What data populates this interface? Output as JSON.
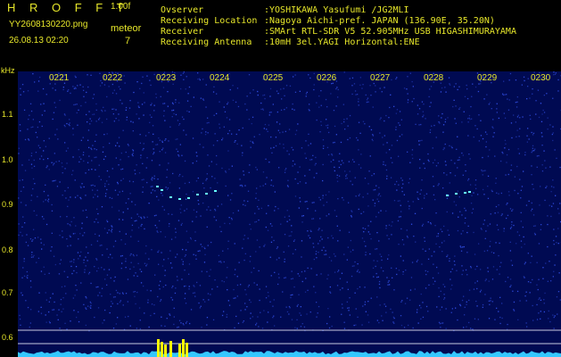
{
  "header": {
    "brand": "H R O F F T",
    "version": "1.00f",
    "filename": "YY2608130220.png",
    "meteor_label": "meteor",
    "datetime": "26.08.13 02:20",
    "meteor_count": "7"
  },
  "info": [
    {
      "key": "Ovserver",
      "value": ":YOSHIKAWA Yasufumi /JG2MLI"
    },
    {
      "key": "Receiving Location",
      "value": ":Nagoya Aichi-pref. JAPAN (136.90E, 35.20N)"
    },
    {
      "key": "Receiver",
      "value": ":SMArt RTL-SDR V5 52.905MHz USB HIGASHIMURAYAMA"
    },
    {
      "key": "Receiving Antenna",
      "value": ":10mH 3el.YAGI Horizontal:ENE"
    }
  ],
  "axis": {
    "unit": "kHz",
    "time_labels": [
      "0221",
      "0222",
      "0223",
      "0224",
      "0225",
      "0226",
      "0227",
      "0228",
      "0229",
      "0230"
    ],
    "freq_labels": [
      "1.1",
      "1.0",
      "0.9",
      "0.8",
      "0.7",
      "0.6"
    ]
  },
  "colors": {
    "text": "#e6e62a",
    "background": "#000a52",
    "noise": "#3a5cff",
    "trace": "#6ff",
    "signal": "#ffff00"
  }
}
